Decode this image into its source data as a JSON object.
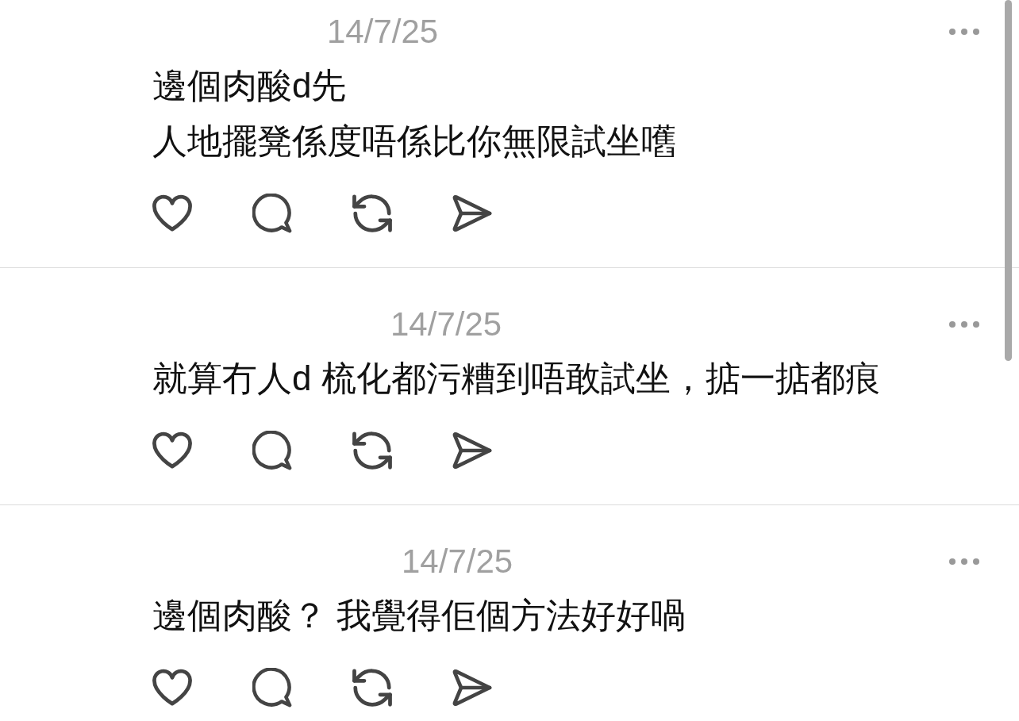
{
  "posts": [
    {
      "date": "14/7/25",
      "text_lines": [
        "邊個肉酸d先",
        "人地擺凳係度唔係比你無限試坐嚿"
      ]
    },
    {
      "date": "14/7/25",
      "text_lines": [
        "就算冇人d 梳化都污糟到唔敢試坐，掂一掂都痕"
      ]
    },
    {
      "date": "14/7/25",
      "text_lines": [
        "邊個肉酸？ 我覺得佢個方法好好喎"
      ]
    }
  ]
}
